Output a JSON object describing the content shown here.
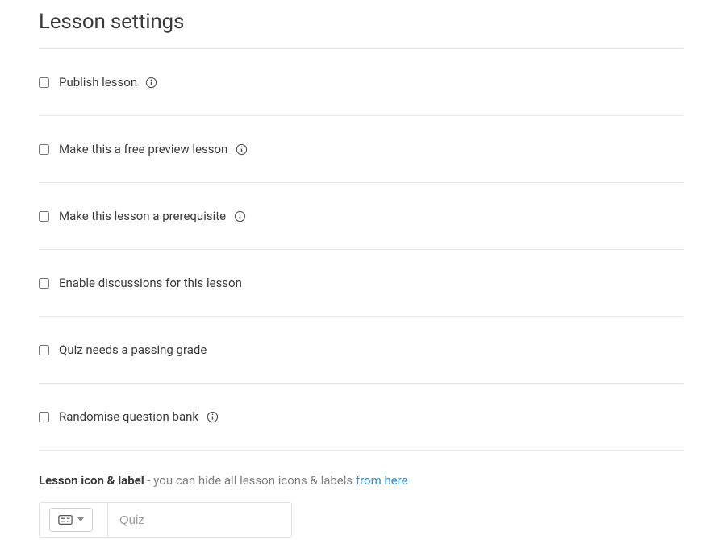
{
  "page_title": "Lesson settings",
  "settings": {
    "publish": {
      "label": "Publish lesson",
      "checked": false,
      "has_info": true
    },
    "free_preview": {
      "label": "Make this a free preview lesson",
      "checked": false,
      "has_info": true
    },
    "prerequisite": {
      "label": "Make this lesson a prerequisite",
      "checked": false,
      "has_info": true
    },
    "discussions": {
      "label": "Enable discussions for this lesson",
      "checked": false,
      "has_info": false
    },
    "passing_grade": {
      "label": "Quiz needs a passing grade",
      "checked": false,
      "has_info": false
    },
    "randomise": {
      "label": "Randomise question bank",
      "checked": false,
      "has_info": true
    }
  },
  "icon_label": {
    "heading_bold": "Lesson icon & label",
    "heading_rest": " - you can hide all lesson icons & labels ",
    "heading_link": "from here",
    "input_placeholder": "Quiz",
    "input_value": ""
  }
}
